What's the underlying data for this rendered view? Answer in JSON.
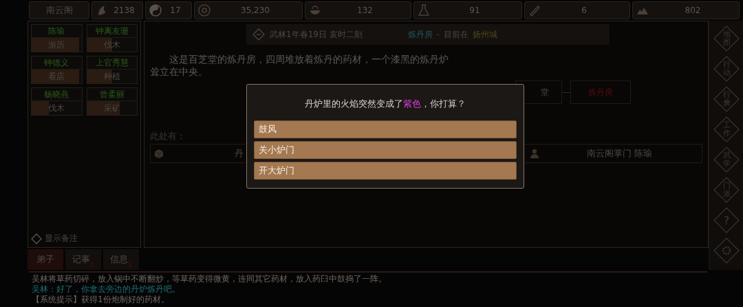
{
  "top_bar": {
    "sect": "南云阁",
    "stats": [
      {
        "value": "2138"
      },
      {
        "value": "17"
      },
      {
        "value": "35,230"
      },
      {
        "value": "132"
      },
      {
        "value": "91"
      },
      {
        "value": "6"
      },
      {
        "value": "802"
      }
    ]
  },
  "disciples": [
    {
      "name": "陈瑜",
      "task": "游历",
      "level": 0.95
    },
    {
      "name": "钟离友珊",
      "task": "伐木",
      "level": 0.5
    },
    {
      "name": "钟德义",
      "task": "看店",
      "level": 0.95
    },
    {
      "name": "上官秀慧",
      "task": "种植",
      "level": 0.5
    },
    {
      "name": "杨晓燕",
      "task": "伐木",
      "level": 0.35
    },
    {
      "name": "曾柔丽",
      "task": "采矿",
      "level": 0.65
    }
  ],
  "show_notes": {
    "label": "显示备注",
    "checked": false
  },
  "left_tabs": [
    {
      "label": "弟子",
      "selected": true
    },
    {
      "label": "记事",
      "badge": "1",
      "selected": false
    },
    {
      "label": "信息",
      "badge": "1",
      "selected": false
    }
  ],
  "header": {
    "date": "武林1年春19日 亥时二刻",
    "room": "炼丹房",
    "separator": "-",
    "location_prefix": "目前在",
    "city": "扬州城"
  },
  "description": "这是百芝堂的炼丹房，四周堆放着炼丹的药材，一个漆黑的炼丹炉耸立在中央。",
  "map_nodes": [
    {
      "label": "堂",
      "selected": false
    },
    {
      "label": "炼丹房",
      "selected": true
    }
  ],
  "here_label": "此处有：",
  "here_items": [
    {
      "kind": "item",
      "label": "丹"
    },
    {
      "kind": "person",
      "label": "南云阁掌门 陈瑜"
    }
  ],
  "sidebar": [
    {
      "label": "地图"
    },
    {
      "label": "行动"
    },
    {
      "label": "行囊"
    },
    {
      "label": "工作"
    },
    {
      "label": "武学"
    },
    {
      "label": "门派"
    },
    {
      "kind": "help",
      "label": "?"
    },
    {
      "kind": "settings"
    }
  ],
  "log": [
    {
      "kind": "narration",
      "text": "吴林将草药切碎，放入锅中不断翻炒，等草药变得微黄，连同其它药材，放入药臼中鼓捣了一阵。"
    },
    {
      "kind": "speech",
      "text": "吴林：好了，你拿去旁边的丹炉炼丹吧。"
    },
    {
      "kind": "system",
      "text": "【系统提示】获得1份炮制好的药材。"
    }
  ],
  "dialog": {
    "question_parts": [
      {
        "text": "丹炉里的火焰突然变成了"
      },
      {
        "text": "紫色",
        "color": "#e040e0"
      },
      {
        "text": "，你打算？"
      }
    ],
    "options": [
      "鼓风",
      "关小炉门",
      "开大炉门"
    ]
  }
}
